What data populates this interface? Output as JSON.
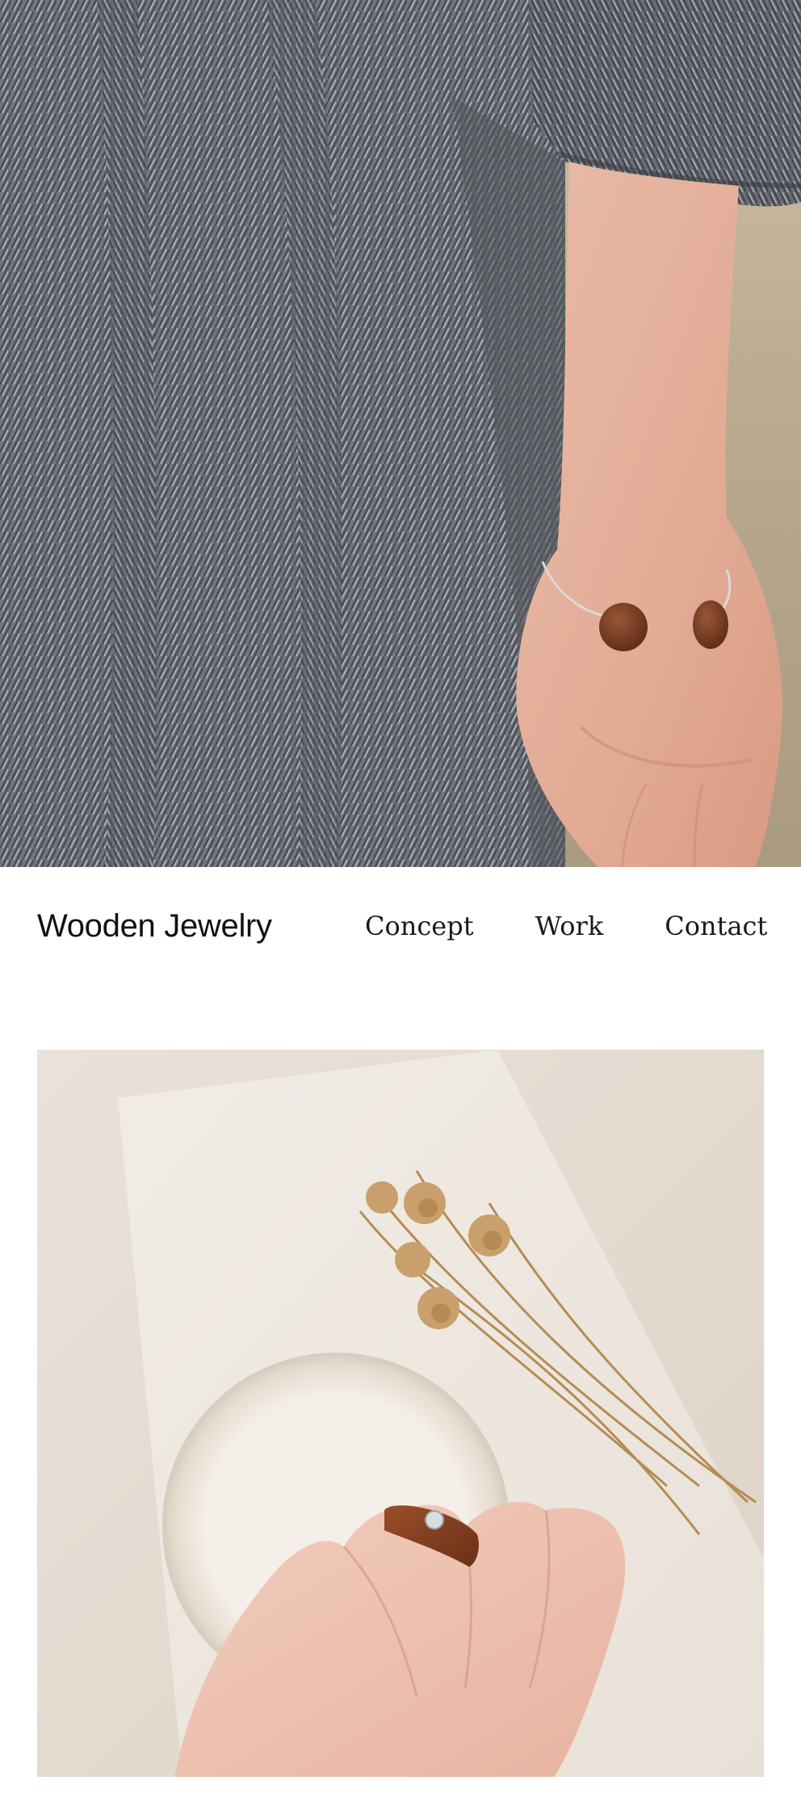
{
  "hero": {
    "image_name": "wooden-bracelet-photo",
    "subject": "wrist-with-wooden-bangle"
  },
  "header": {
    "brand": "Wooden Jewelry",
    "nav": {
      "concept": "Concept",
      "work": "Work",
      "contact": "Contact"
    }
  },
  "gallery": {
    "image_name": "wooden-ring-photo",
    "subject": "hand-with-wooden-ring"
  },
  "colors": {
    "background": "#ffffff",
    "text": "#1a1a1a",
    "fabric": "#6f7278",
    "skin": "#e9b9a4",
    "wood": "#7a3d22",
    "photo_bg": "#e6ded4"
  }
}
